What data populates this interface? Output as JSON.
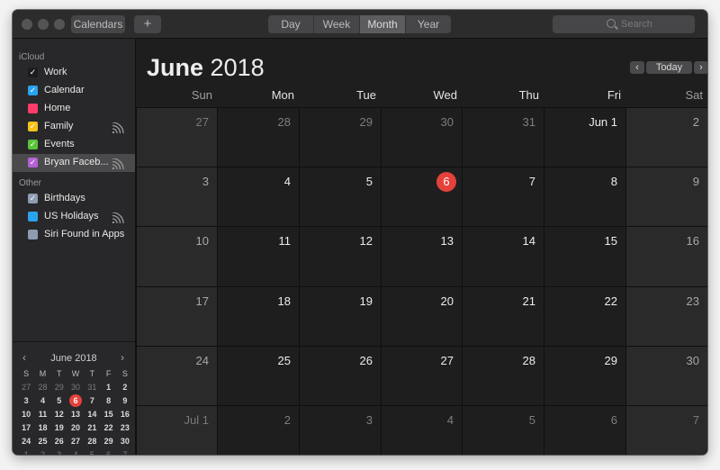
{
  "toolbar": {
    "calendars_label": "Calendars",
    "add_label": "+",
    "views": [
      "Day",
      "Week",
      "Month",
      "Year"
    ],
    "active_view": "Month",
    "search_placeholder": "Search"
  },
  "sidebar": {
    "groups": [
      {
        "title": "iCloud",
        "items": [
          {
            "label": "Work",
            "color": "#1c1c1c",
            "checked": true,
            "shared": false,
            "selected": false
          },
          {
            "label": "Calendar",
            "color": "#2aa3ef",
            "checked": true,
            "shared": false,
            "selected": false
          },
          {
            "label": "Home",
            "color": "#fc3d6a",
            "checked": false,
            "shared": false,
            "selected": false
          },
          {
            "label": "Family",
            "color": "#f5c21b",
            "checked": true,
            "shared": true,
            "selected": false
          },
          {
            "label": "Events",
            "color": "#5ac43a",
            "checked": true,
            "shared": false,
            "selected": false
          },
          {
            "label": "Bryan Faceb...",
            "color": "#b561d6",
            "checked": true,
            "shared": true,
            "selected": true
          }
        ]
      },
      {
        "title": "Other",
        "items": [
          {
            "label": "Birthdays",
            "color": "#8e9bb0",
            "checked": true,
            "shared": false,
            "selected": false
          },
          {
            "label": "US Holidays",
            "color": "#2aa3ef",
            "checked": false,
            "shared": true,
            "selected": false
          },
          {
            "label": "Siri Found in Apps",
            "color": "#8e9bb0",
            "checked": false,
            "shared": false,
            "selected": false
          }
        ]
      }
    ]
  },
  "mini_calendar": {
    "title": "June 2018",
    "prev": "‹",
    "next": "›",
    "weekday_heads": [
      "S",
      "M",
      "T",
      "W",
      "T",
      "F",
      "S"
    ],
    "weeks": [
      [
        [
          "27",
          1
        ],
        [
          "28",
          1
        ],
        [
          "29",
          1
        ],
        [
          "30",
          1
        ],
        [
          "31",
          1
        ],
        [
          "1",
          0
        ],
        [
          "2",
          0
        ]
      ],
      [
        [
          "3",
          0
        ],
        [
          "4",
          0
        ],
        [
          "5",
          0
        ],
        [
          "6",
          2
        ],
        [
          "7",
          0
        ],
        [
          "8",
          0
        ],
        [
          "9",
          0
        ]
      ],
      [
        [
          "10",
          0
        ],
        [
          "11",
          0
        ],
        [
          "12",
          0
        ],
        [
          "13",
          0
        ],
        [
          "14",
          0
        ],
        [
          "15",
          0
        ],
        [
          "16",
          0
        ]
      ],
      [
        [
          "17",
          0
        ],
        [
          "18",
          0
        ],
        [
          "19",
          0
        ],
        [
          "20",
          0
        ],
        [
          "21",
          0
        ],
        [
          "22",
          0
        ],
        [
          "23",
          0
        ]
      ],
      [
        [
          "24",
          0
        ],
        [
          "25",
          0
        ],
        [
          "26",
          0
        ],
        [
          "27",
          0
        ],
        [
          "28",
          0
        ],
        [
          "29",
          0
        ],
        [
          "30",
          0
        ]
      ],
      [
        [
          "1",
          1
        ],
        [
          "2",
          1
        ],
        [
          "3",
          1
        ],
        [
          "4",
          1
        ],
        [
          "5",
          1
        ],
        [
          "6",
          1
        ],
        [
          "7",
          1
        ]
      ]
    ]
  },
  "main": {
    "month_bold": "June",
    "year": "2018",
    "prev": "‹",
    "today_label": "Today",
    "next": "›",
    "weekdays": [
      "Sun",
      "Mon",
      "Tue",
      "Wed",
      "Thu",
      "Fri",
      "Sat"
    ],
    "weeks": [
      [
        [
          "27",
          1
        ],
        [
          "28",
          1
        ],
        [
          "29",
          1
        ],
        [
          "30",
          1
        ],
        [
          "31",
          1
        ],
        [
          "Jun 1",
          0
        ],
        [
          "2",
          0
        ]
      ],
      [
        [
          "3",
          0
        ],
        [
          "4",
          0
        ],
        [
          "5",
          0
        ],
        [
          "6",
          2
        ],
        [
          "7",
          0
        ],
        [
          "8",
          0
        ],
        [
          "9",
          0
        ]
      ],
      [
        [
          "10",
          0
        ],
        [
          "11",
          0
        ],
        [
          "12",
          0
        ],
        [
          "13",
          0
        ],
        [
          "14",
          0
        ],
        [
          "15",
          0
        ],
        [
          "16",
          0
        ]
      ],
      [
        [
          "17",
          0
        ],
        [
          "18",
          0
        ],
        [
          "19",
          0
        ],
        [
          "20",
          0
        ],
        [
          "21",
          0
        ],
        [
          "22",
          0
        ],
        [
          "23",
          0
        ]
      ],
      [
        [
          "24",
          0
        ],
        [
          "25",
          0
        ],
        [
          "26",
          0
        ],
        [
          "27",
          0
        ],
        [
          "28",
          0
        ],
        [
          "29",
          0
        ],
        [
          "30",
          0
        ]
      ],
      [
        [
          "Jul 1",
          1
        ],
        [
          "2",
          1
        ],
        [
          "3",
          1
        ],
        [
          "4",
          1
        ],
        [
          "5",
          1
        ],
        [
          "6",
          1
        ],
        [
          "7",
          1
        ]
      ]
    ]
  },
  "colors": {
    "today": "#e5413b",
    "accent": "#2aa3ef"
  }
}
